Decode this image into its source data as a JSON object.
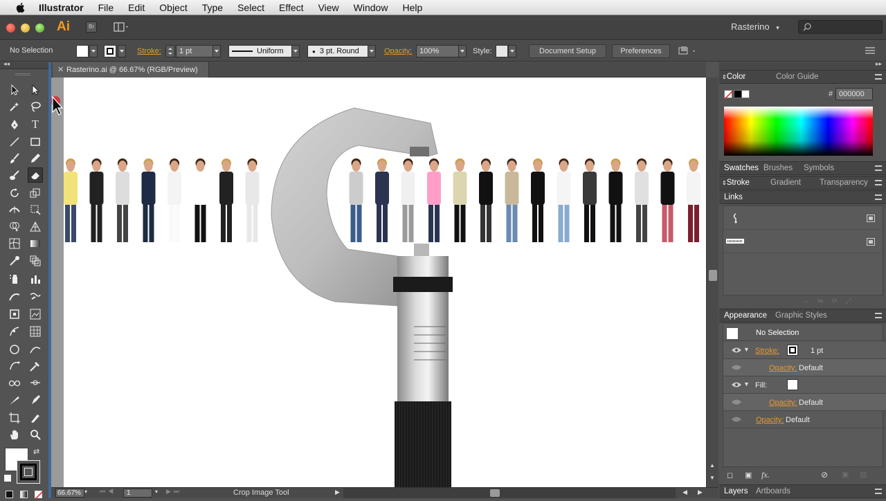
{
  "menubar": {
    "app_name": "Illustrator",
    "items": [
      "File",
      "Edit",
      "Object",
      "Type",
      "Select",
      "Effect",
      "View",
      "Window",
      "Help"
    ]
  },
  "appbar": {
    "logo": "Ai",
    "bridge_label": "Br",
    "workspace": "Rasterino"
  },
  "controlbar": {
    "selection_status": "No Selection",
    "stroke_label": "Stroke:",
    "stroke_weight": "1 pt",
    "stroke_profile": "Uniform",
    "brush_label": "3 pt. Round",
    "opacity_label": "Opacity:",
    "opacity_value": "100%",
    "style_label": "Style:",
    "document_setup": "Document Setup",
    "preferences": "Preferences"
  },
  "document": {
    "tab_title": "Rasterino.ai @ 66.67% (RGB/Preview)"
  },
  "statusbar": {
    "zoom": "66.67%",
    "artboard_number": "1",
    "current_tool": "Crop Image Tool"
  },
  "color_panel": {
    "tab_color": "Color",
    "tab_color_guide": "Color Guide",
    "hex_label": "#",
    "hex_value": "000000"
  },
  "swatches_panel": {
    "tabs": [
      "Swatches",
      "Brushes",
      "Symbols"
    ]
  },
  "stroke_panel": {
    "tabs": [
      "Stroke",
      "Gradient",
      "Transparency"
    ]
  },
  "links_panel": {
    "tab": "Links"
  },
  "appearance_panel": {
    "tab_appearance": "Appearance",
    "tab_graphic_styles": "Graphic Styles",
    "selection": "No Selection",
    "stroke_label": "Stroke:",
    "stroke_value": "1 pt",
    "stroke_opacity_label": "Opacity:",
    "stroke_opacity_value": "Default",
    "fill_label": "Fill:",
    "fill_opacity_label": "Opacity:",
    "fill_opacity_value": "Default",
    "opacity_label": "Opacity:",
    "opacity_value": "Default"
  },
  "bottom_tabs": {
    "layers": "Layers",
    "artboards": "Artboards"
  },
  "colors": {
    "accent_orange": "#f39a1e",
    "panel_bg": "#535353",
    "appbar_bg": "#424242"
  }
}
